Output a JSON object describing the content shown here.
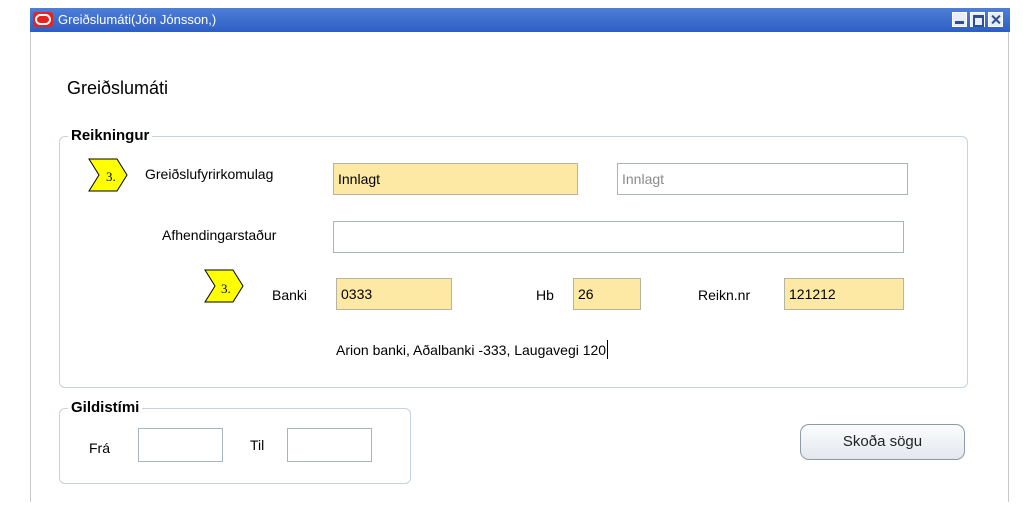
{
  "window": {
    "title": "Greiðslumáti(Jón Jónsson,)"
  },
  "page": {
    "title": "Greiðslumáti"
  },
  "reikningur": {
    "legend": "Reikningur",
    "greidslufyrirkomulag": {
      "label": "Greiðslufyrirkomulag",
      "value": "Innlagt",
      "display_value": "Innlagt"
    },
    "afhendingarstadur": {
      "label": "Afhendingarstaður",
      "value": ""
    },
    "banki": {
      "label": "Banki",
      "value": "0333"
    },
    "hb": {
      "label": "Hb",
      "value": "26"
    },
    "reikn_nr": {
      "label": "Reikn.nr",
      "value": "121212"
    },
    "bank_description": "Arion banki, Aðalbanki -333, Laugavegi 120"
  },
  "gildistimi": {
    "legend": "Gildistími",
    "fra": {
      "label": "Frá",
      "value": ""
    },
    "til": {
      "label": "Til",
      "value": ""
    }
  },
  "markers": {
    "step_label": "3."
  },
  "buttons": {
    "history_label": "Skoða sögu"
  },
  "colors": {
    "titlebar": "#2d5ec4",
    "required_field": "#fde9a4",
    "group_border": "#c5d2e0",
    "marker_fill": "#ffff00"
  },
  "icons": {
    "app_logo": "oracle-logo-icon",
    "minimize": "minimize-icon",
    "maximize": "maximize-icon",
    "close": "close-icon",
    "step_marker": "step-flag-icon"
  }
}
